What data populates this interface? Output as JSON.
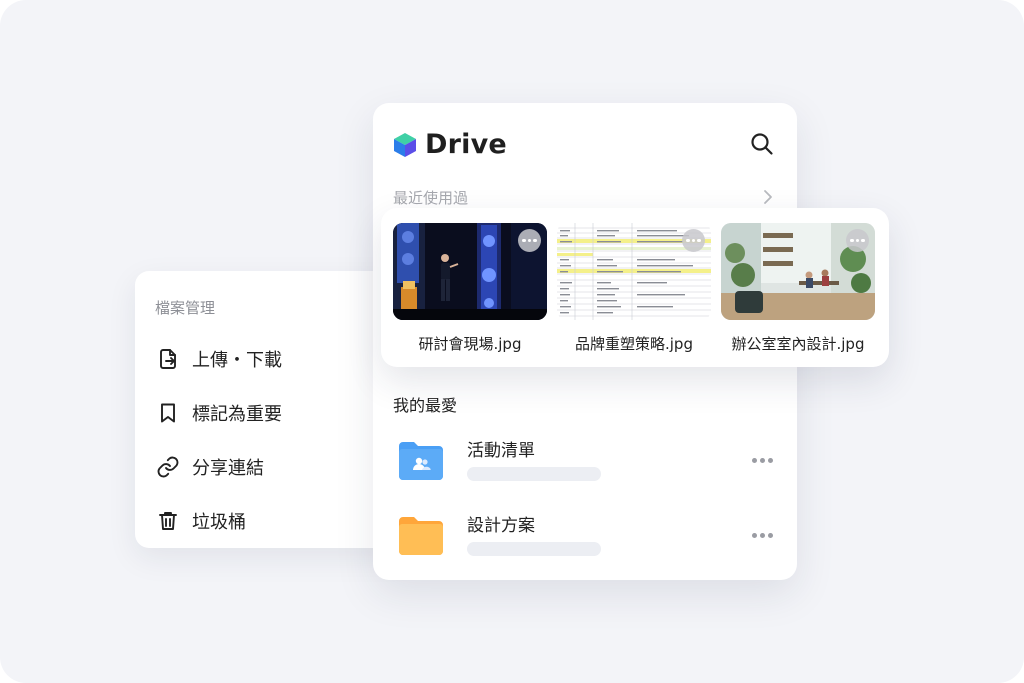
{
  "menu": {
    "title": "檔案管理",
    "items": [
      {
        "label": "上傳・下載",
        "icon": "file-transfer-icon"
      },
      {
        "label": "標記為重要",
        "icon": "bookmark-icon"
      },
      {
        "label": "分享連結",
        "icon": "link-icon"
      },
      {
        "label": "垃圾桶",
        "icon": "trash-icon"
      }
    ]
  },
  "drive": {
    "app_name": "Drive",
    "recent_label": "最近使用過",
    "favorites_label": "我的最愛",
    "recent_files": [
      {
        "name": "研討會現場.jpg"
      },
      {
        "name": "品牌重塑策略.jpg"
      },
      {
        "name": "辦公室室內設計.jpg"
      }
    ],
    "favorites": [
      {
        "name": "活動清單",
        "icon": "shared-folder-icon",
        "color": "#4a9ff5"
      },
      {
        "name": "設計方案",
        "icon": "folder-icon",
        "color": "#ffb547"
      }
    ]
  }
}
